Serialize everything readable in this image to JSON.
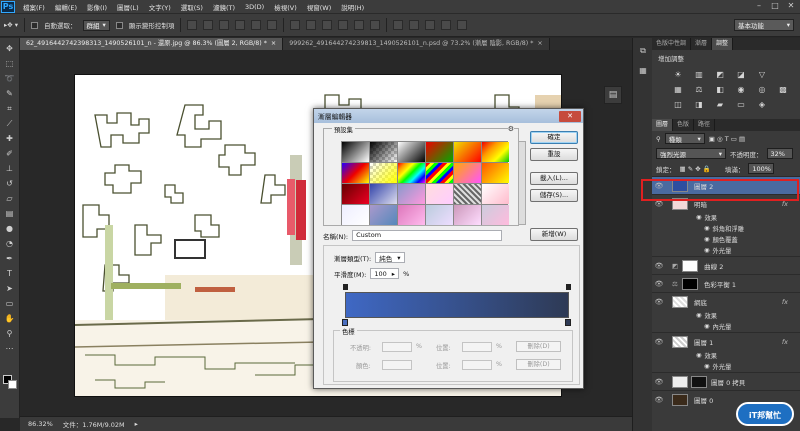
{
  "app": {
    "logo": "Ps"
  },
  "menu": [
    "檔案(F)",
    "編輯(E)",
    "影像(I)",
    "圖層(L)",
    "文字(Y)",
    "選取(S)",
    "濾鏡(T)",
    "3D(D)",
    "檢視(V)",
    "視窗(W)",
    "說明(H)"
  ],
  "window_controls": {
    "minimize": "–",
    "maximize": "□",
    "close": "✕"
  },
  "options": {
    "auto_select_label": "自動選取：",
    "auto_select_value": "群組",
    "transform_label": "顯示變形控制項"
  },
  "workspace": "基本功能",
  "doc_tabs": [
    {
      "label": "62_4916442742398313_1490526101_n - 還原.jpg @ 86.3% (圖層 2, RGB/8) *",
      "close": "×"
    },
    {
      "label": "999262_491644274239813_1490526101_n.psd @ 73.2% (漸層 陰影, RGB/8) *",
      "close": "×"
    }
  ],
  "status": {
    "zoom": "86.32%",
    "doc": "文件：1.76M/9.02M"
  },
  "panels": {
    "top_tabs": [
      "色版中性調",
      "漸層",
      "調整"
    ],
    "adjust_title": "增加調整",
    "layers_tabs": [
      "圖層",
      "色版",
      "路徑"
    ],
    "kind": "種類",
    "blend": "強烈光源",
    "opacity_label": "不透明度：",
    "opacity": "32%",
    "lock_label": "鎖定：",
    "fill_label": "填滿：",
    "fill": "100%"
  },
  "layers": [
    {
      "name": "圖層 2",
      "selected": true,
      "thumb": "#2e4ea0"
    },
    {
      "name": "明暗",
      "selected": false,
      "thumb": "#f2d8d8",
      "fx": "fx"
    },
    {
      "name": "曲線 2",
      "selected": false,
      "thumb": "#ffffff"
    },
    {
      "name": "色彩平衡 1",
      "selected": false,
      "thumb": "#000000"
    },
    {
      "name": "網底",
      "selected": false,
      "thumb": "#cccccc",
      "fx": "fx"
    },
    {
      "name": "圖層 1",
      "selected": false,
      "thumb": "#dddddd",
      "fx": "fx"
    },
    {
      "name": "圖層 0 拷貝",
      "selected": false,
      "thumb": "#111111"
    },
    {
      "name": "圖層 0",
      "selected": false,
      "thumb": "#3a2a1a"
    }
  ],
  "layer_effects": {
    "l1": [
      "效果",
      "斜角和浮雕",
      "顏色覆蓋",
      "外光暈"
    ],
    "l4": [
      "效果",
      "內光暈"
    ],
    "l5": [
      "效果",
      "外光暈"
    ]
  },
  "dialog": {
    "title": "漸層編輯器",
    "presets_label": "預設集",
    "ok": "確定",
    "cancel": "重設",
    "load": "載入(L)...",
    "save": "儲存(S)...",
    "new": "新增(W)",
    "name_label": "名稱(N):",
    "name_value": "Custom",
    "type_label": "漸層類型(T):",
    "type_value": "純色",
    "smooth_label": "平滑度(M):",
    "smooth_value": "100",
    "smooth_unit": "%",
    "stops_label": "色標",
    "opacity_label": "不透明:",
    "color_label": "顏色:",
    "location_label": "位置:",
    "pct": "%",
    "delete": "刪除(D)",
    "colors": {
      "start": "#3f68c4",
      "end": "#2e3a55"
    }
  },
  "watermark": "iT邦幫忙"
}
